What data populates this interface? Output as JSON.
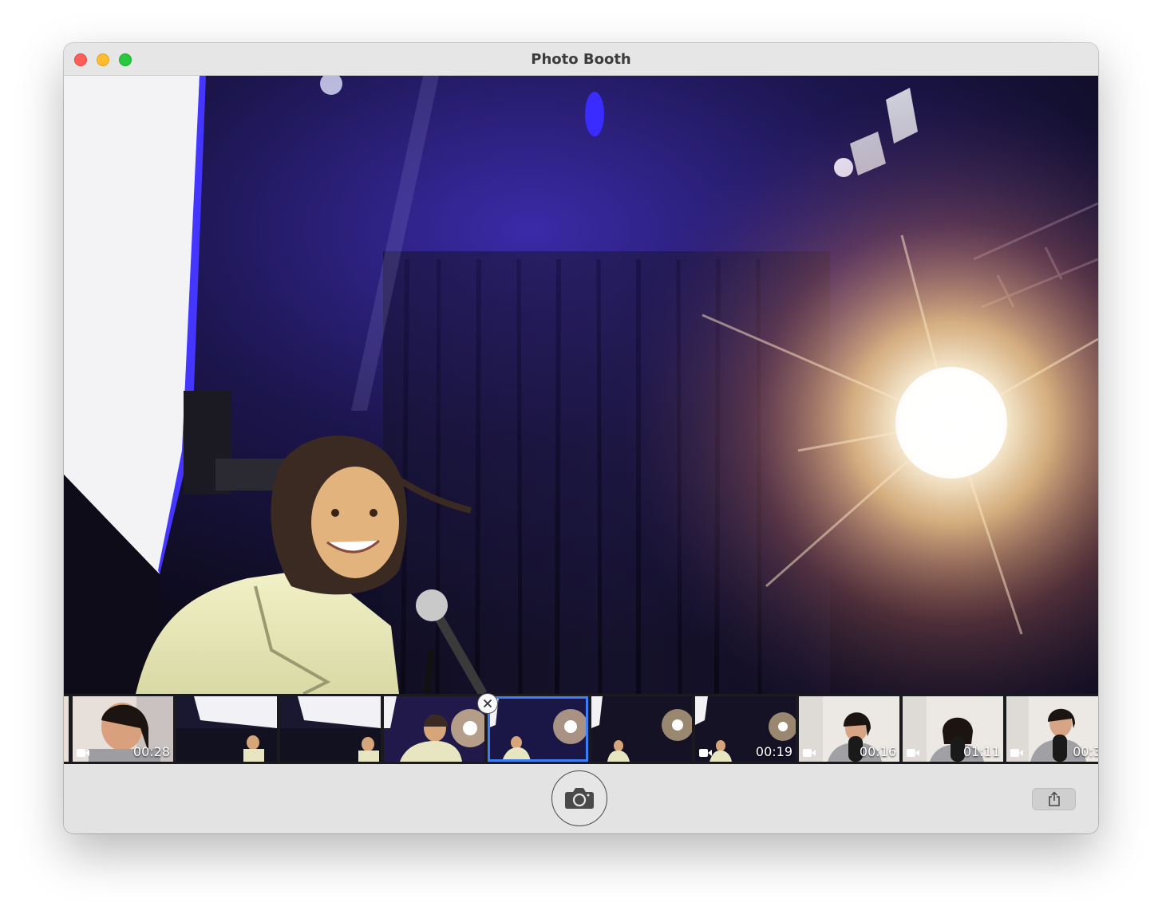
{
  "window": {
    "title": "Photo Booth"
  },
  "preview": {
    "description_icon": "camera-live-preview"
  },
  "filmstrip": {
    "selected_index": 4,
    "items": [
      {
        "type": "video",
        "duration": "00:28",
        "scene": "close-up"
      },
      {
        "type": "photo",
        "duration": "",
        "scene": "stage"
      },
      {
        "type": "photo",
        "duration": "",
        "scene": "stage"
      },
      {
        "type": "photo",
        "duration": "",
        "scene": "stage-close"
      },
      {
        "type": "photo",
        "duration": "",
        "scene": "stage-flare"
      },
      {
        "type": "photo",
        "duration": "",
        "scene": "stage-flare"
      },
      {
        "type": "video",
        "duration": "00:19",
        "scene": "stage-flare"
      },
      {
        "type": "video",
        "duration": "00:16",
        "scene": "studio-mic"
      },
      {
        "type": "video",
        "duration": "01:11",
        "scene": "studio-mic"
      },
      {
        "type": "video",
        "duration": "00:3",
        "scene": "studio-mic"
      }
    ]
  },
  "toolbar": {
    "shutter_icon": "camera-icon",
    "share_icon": "share-icon"
  },
  "colors": {
    "selection": "#3e7ef6",
    "close": "#ff5f57",
    "minimize": "#febc2e",
    "maximize": "#28c840"
  }
}
